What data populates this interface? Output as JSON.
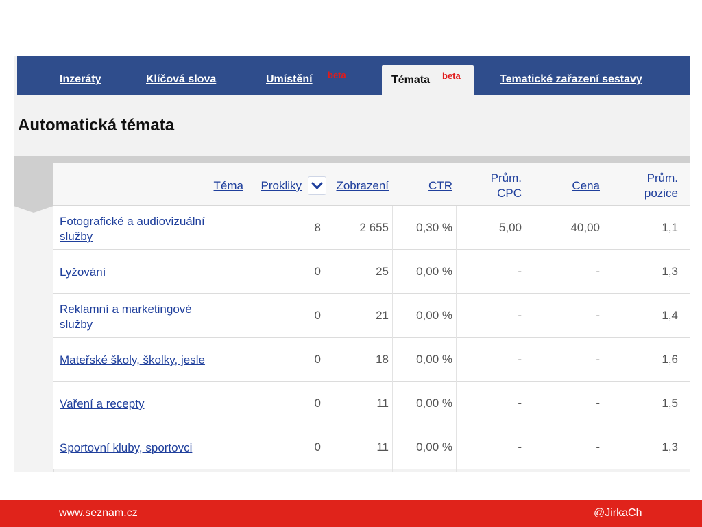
{
  "tabs": [
    {
      "label": "Inzeráty"
    },
    {
      "label": "Klíčová slova"
    },
    {
      "label": "Umístění",
      "badge": "beta"
    },
    {
      "label": "Témata",
      "badge": "beta"
    },
    {
      "label": "Tematické zařazení sestavy"
    }
  ],
  "page_title": "Automatická témata",
  "columns": {
    "tema": "Téma",
    "prokliky": "Prokliky",
    "zobrazeni": "Zobrazení",
    "ctr": "CTR",
    "prum_cpc_1": "Prům.",
    "prum_cpc_2": "CPC",
    "cena": "Cena",
    "prum_pozice_1": "Prům.",
    "prum_pozice_2": "pozice"
  },
  "rows": [
    {
      "topic_1": "Fotografické a audiovizuální",
      "topic_2": "služby",
      "prokliky": "8",
      "zobrazeni": "2 655",
      "ctr": "0,30 %",
      "cpc": "5,00",
      "cena": "40,00",
      "pozice": "1,1"
    },
    {
      "topic_1": "Lyžování",
      "topic_2": "",
      "prokliky": "0",
      "zobrazeni": "25",
      "ctr": "0,00 %",
      "cpc": "-",
      "cena": "-",
      "pozice": "1,3"
    },
    {
      "topic_1": "Reklamní a marketingové",
      "topic_2": "služby",
      "prokliky": "0",
      "zobrazeni": "21",
      "ctr": "0,00 %",
      "cpc": "-",
      "cena": "-",
      "pozice": "1,4"
    },
    {
      "topic_1": "Mateřské školy, školky, jesle",
      "topic_2": "",
      "prokliky": "0",
      "zobrazeni": "18",
      "ctr": "0,00 %",
      "cpc": "-",
      "cena": "-",
      "pozice": "1,6"
    },
    {
      "topic_1": "Vaření a recepty",
      "topic_2": "",
      "prokliky": "0",
      "zobrazeni": "11",
      "ctr": "0,00 %",
      "cpc": "-",
      "cena": "-",
      "pozice": "1,5"
    },
    {
      "topic_1": "Sportovní kluby, sportovci",
      "topic_2": "",
      "prokliky": "0",
      "zobrazeni": "11",
      "ctr": "0,00 %",
      "cpc": "-",
      "cena": "-",
      "pozice": "1,3"
    }
  ],
  "footer": {
    "left": "www.seznam.cz",
    "right": "@JirkaCh"
  },
  "colors": {
    "tabbar": "#2f4d8c",
    "link": "#1f3f9c",
    "beta": "#e01b1b",
    "footer": "#e0231b"
  },
  "icons": {
    "sort": "chevron-down-icon"
  }
}
